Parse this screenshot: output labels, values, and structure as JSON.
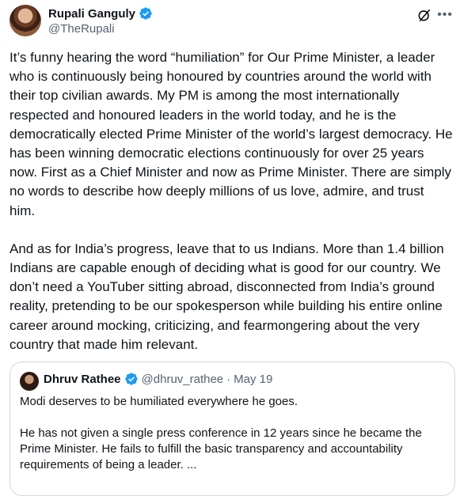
{
  "author": {
    "name": "Rupali Ganguly",
    "handle": "@TheRupali"
  },
  "tweet": {
    "paragraphs": [
      "It’s funny hearing the word “humiliation” for Our Prime Minister, a leader who is continuously being honoured by countries around the world with their top civilian awards. My PM is among the most internationally respected and honoured leaders in the world today, and he is the democratically elected Prime Minister of the world’s largest democracy. He has been winning democratic elections continuously for over 25 years now. First as a Chief Minister and now as Prime Minister. There are simply no words to describe how deeply millions of us love, admire, and trust him.",
      "And as for India’s progress, leave that to us Indians. More than 1.4 billion Indians are capable enough of deciding what is good for our country. We don’t need a YouTuber sitting abroad, disconnected from India’s ground reality, pretending to be our spokesperson while building his entire online career around mocking, criticizing, and fearmongering about the very country that made him relevant."
    ]
  },
  "quote": {
    "name": "Dhruv Rathee",
    "handle": "@dhruv_rathee",
    "separator": "·",
    "date": "May 19",
    "paragraphs": [
      "Modi deserves to be humiliated everywhere he goes.",
      "He has not given a single press conference in 12 years since he became the Prime Minister. He fails to fulfill the basic transparency and accountability requirements of being a leader. ..."
    ]
  },
  "icons": {
    "verified": "verified-badge-icon",
    "grok": "grok-icon",
    "more": "more-options-icon"
  },
  "colors": {
    "verified": "#1d9bf0",
    "text": "#0f1419",
    "secondary": "#536471",
    "border": "#cfd9de"
  }
}
